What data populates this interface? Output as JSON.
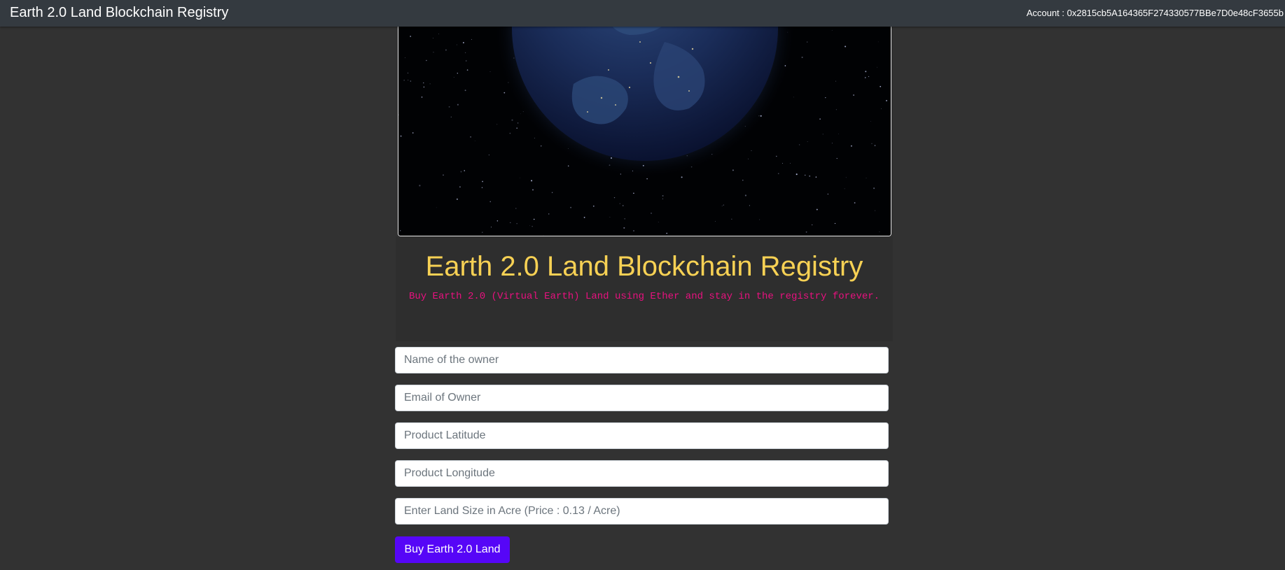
{
  "navbar": {
    "brand": "Earth 2.0 Land Blockchain Registry",
    "account_label": "Account : 0x2815cb5A164365F274330577BBe7D0e48cF3655b"
  },
  "hero": {
    "image": "earth-at-night-from-space"
  },
  "jumbotron": {
    "title": "Earth 2.0 Land Blockchain Registry",
    "subtitle": "Buy Earth 2.0 (Virtual Earth) Land using Ether and stay in the registry forever."
  },
  "form": {
    "owner_name": {
      "placeholder": "Name of the owner",
      "value": ""
    },
    "owner_email": {
      "placeholder": "Email of Owner",
      "value": ""
    },
    "latitude": {
      "placeholder": "Product Latitude",
      "value": ""
    },
    "longitude": {
      "placeholder": "Product Longitude",
      "value": ""
    },
    "land_size": {
      "placeholder": "Enter Land Size in Acre (Price : 0.13 / Acre)",
      "value": ""
    },
    "submit_label": "Buy Earth 2.0 Land"
  },
  "colors": {
    "navbar_bg": "#343a40",
    "page_bg": "#323232",
    "title": "#f7d154",
    "subtitle": "#e8117f",
    "button": "#5606f7"
  }
}
